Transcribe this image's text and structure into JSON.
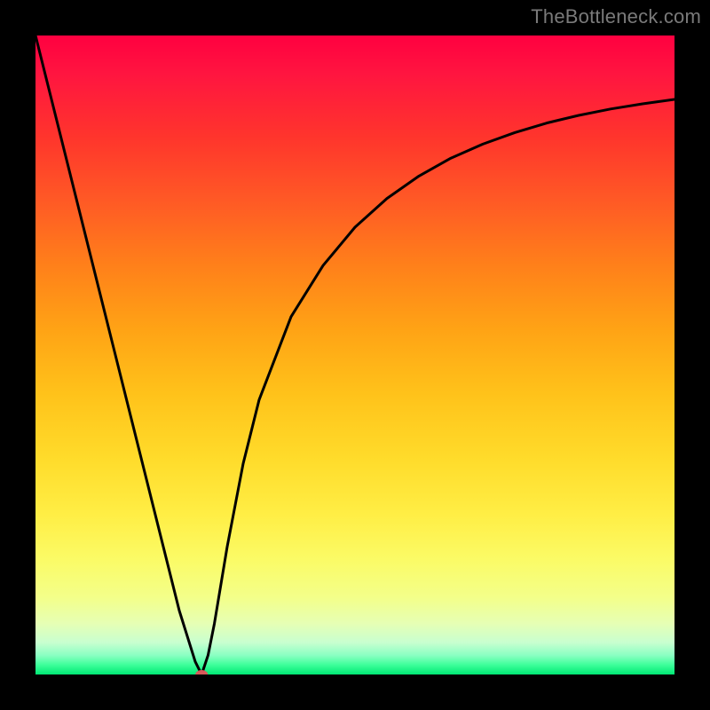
{
  "watermark": "TheBottleneck.com",
  "chart_data": {
    "type": "line",
    "title": "",
    "xlabel": "",
    "ylabel": "",
    "xlim": [
      0,
      100
    ],
    "ylim": [
      0,
      100
    ],
    "series": [
      {
        "name": "curve",
        "x": [
          0,
          5,
          10,
          15,
          20,
          22.5,
          25,
          26,
          27,
          28,
          30,
          32.5,
          35,
          40,
          45,
          50,
          55,
          60,
          65,
          70,
          75,
          80,
          85,
          90,
          95,
          100
        ],
        "values": [
          100,
          80,
          60,
          40,
          20,
          10,
          2,
          0,
          3,
          8,
          20,
          33,
          43,
          56,
          64,
          70,
          74.5,
          78,
          80.8,
          83,
          84.8,
          86.3,
          87.5,
          88.5,
          89.3,
          90
        ]
      }
    ],
    "marker": {
      "x": 26,
      "y": 0,
      "color": "#d75a5a",
      "rx": 7,
      "ry": 5
    },
    "background": "rainbow-vertical"
  }
}
